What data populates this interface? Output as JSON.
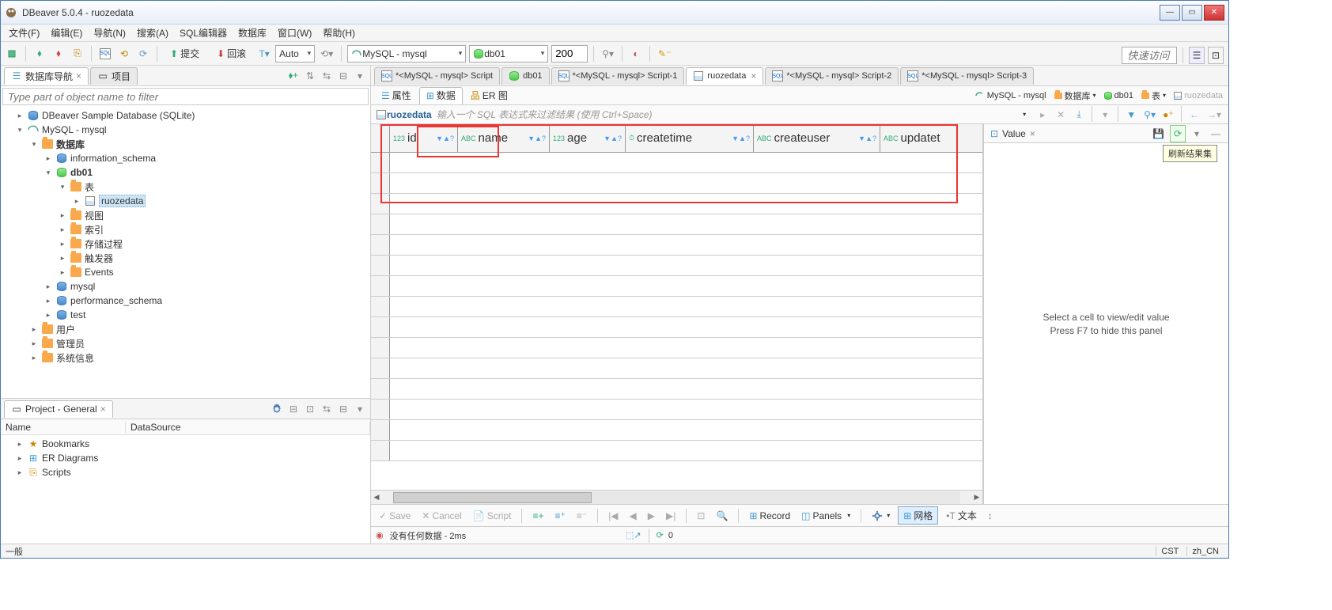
{
  "window": {
    "title": "DBeaver 5.0.4 - ruozedata"
  },
  "menubar": [
    "文件(F)",
    "编辑(E)",
    "导航(N)",
    "搜索(A)",
    "SQL编辑器",
    "数据库",
    "窗口(W)",
    "帮助(H)"
  ],
  "toolbar": {
    "commit": "提交",
    "rollback": "回滚",
    "auto": "Auto",
    "connection": "MySQL - mysql",
    "database": "db01",
    "limit": "200",
    "quick_access": "快速访问"
  },
  "nav_view": {
    "tab1": "数据库导航",
    "tab2": "项目",
    "filter_placeholder": "Type part of object name to filter"
  },
  "tree": {
    "n0": "DBeaver Sample Database (SQLite)",
    "n1": "MySQL - mysql",
    "n2": "数据库",
    "n3": "information_schema",
    "n4": "db01",
    "n5": "表",
    "n6": "ruozedata",
    "n7": "视图",
    "n8": "索引",
    "n9": "存储过程",
    "n10": "触发器",
    "n11": "Events",
    "n12": "mysql",
    "n13": "performance_schema",
    "n14": "test",
    "n15": "用户",
    "n16": "管理员",
    "n17": "系统信息"
  },
  "project_panel": {
    "title": "Project - General",
    "col_name": "Name",
    "col_ds": "DataSource",
    "bookmarks": "Bookmarks",
    "er": "ER Diagrams",
    "scripts": "Scripts"
  },
  "editor_tabs": {
    "t1": "*<MySQL - mysql> Script",
    "t2": "db01",
    "t3": "*<MySQL - mysql> Script-1",
    "t4": "ruozedata",
    "t5": "*<MySQL - mysql> Script-2",
    "t6": "*<MySQL - mysql> Script-3"
  },
  "sub_tabs": {
    "props": "属性",
    "data": "数据",
    "er": "ER 图"
  },
  "breadcrumb": {
    "conn": "MySQL - mysql",
    "db_label": "数据库",
    "db": "db01",
    "tbl_label": "表",
    "tbl": "ruozedata"
  },
  "data_header": {
    "table_name": "ruozedata",
    "hint": "输入一个 SQL 表达式来过滤结果 (使用 Ctrl+Space)"
  },
  "columns": [
    "id",
    "name",
    "age",
    "createtime",
    "createuser",
    "updatet"
  ],
  "column_types": [
    "123",
    "ABC",
    "123",
    "⏱",
    "ABC",
    "ABC"
  ],
  "value_panel": {
    "title": "Value",
    "msg1": "Select a cell to view/edit value",
    "msg2": "Press F7 to hide this panel"
  },
  "tooltip": "刷新结果集",
  "bottom_bar": {
    "save": "Save",
    "cancel": "Cancel",
    "script": "Script",
    "record": "Record",
    "panels": "Panels",
    "grid": "网格",
    "text": "文本"
  },
  "status_row": {
    "msg": "没有任何数据 - 2ms",
    "count": "0"
  },
  "statusbar": {
    "left": "一般",
    "cst": "CST",
    "locale": "zh_CN"
  }
}
